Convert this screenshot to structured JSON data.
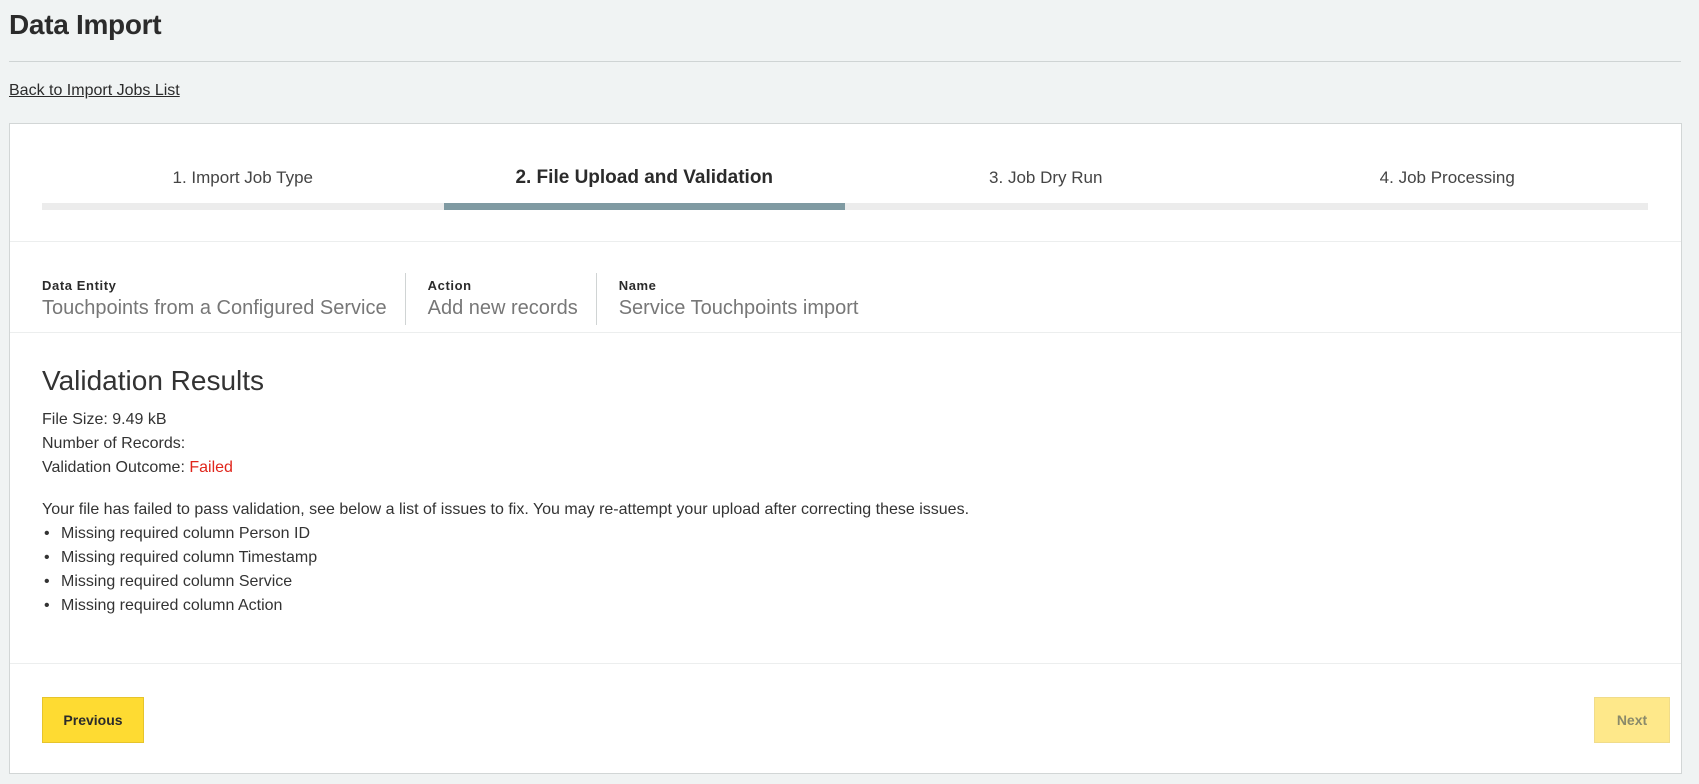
{
  "header": {
    "title": "Data Import"
  },
  "back_link": "Back to Import Jobs List",
  "stepper": {
    "steps": [
      {
        "label": "1. Import Job Type",
        "active": false
      },
      {
        "label": "2. File Upload and Validation",
        "active": true
      },
      {
        "label": "3. Job Dry Run",
        "active": false
      },
      {
        "label": "4. Job Processing",
        "active": false
      }
    ]
  },
  "meta": {
    "data_entity_label": "Data Entity",
    "data_entity_value": "Touchpoints from a Configured Service",
    "action_label": "Action",
    "action_value": "Add new records",
    "name_label": "Name",
    "name_value": "Service Touchpoints import"
  },
  "results": {
    "title": "Validation Results",
    "file_size_label": "File Size:",
    "file_size_value": "9.49 kB",
    "records_label": "Number of Records:",
    "records_value": "",
    "outcome_label": "Validation Outcome:",
    "outcome_value": "Failed",
    "message": "Your file has failed to pass validation, see below a list of issues to fix. You may re-attempt your upload after correcting these issues.",
    "issues": [
      "Missing required column Person ID",
      "Missing required column Timestamp",
      "Missing required column Service",
      "Missing required column Action"
    ]
  },
  "buttons": {
    "previous": "Previous",
    "next": "Next"
  },
  "colors": {
    "accent_yellow": "#fedb32",
    "active_step_bar": "#7f9aa2",
    "failed_red": "#e0251b"
  }
}
